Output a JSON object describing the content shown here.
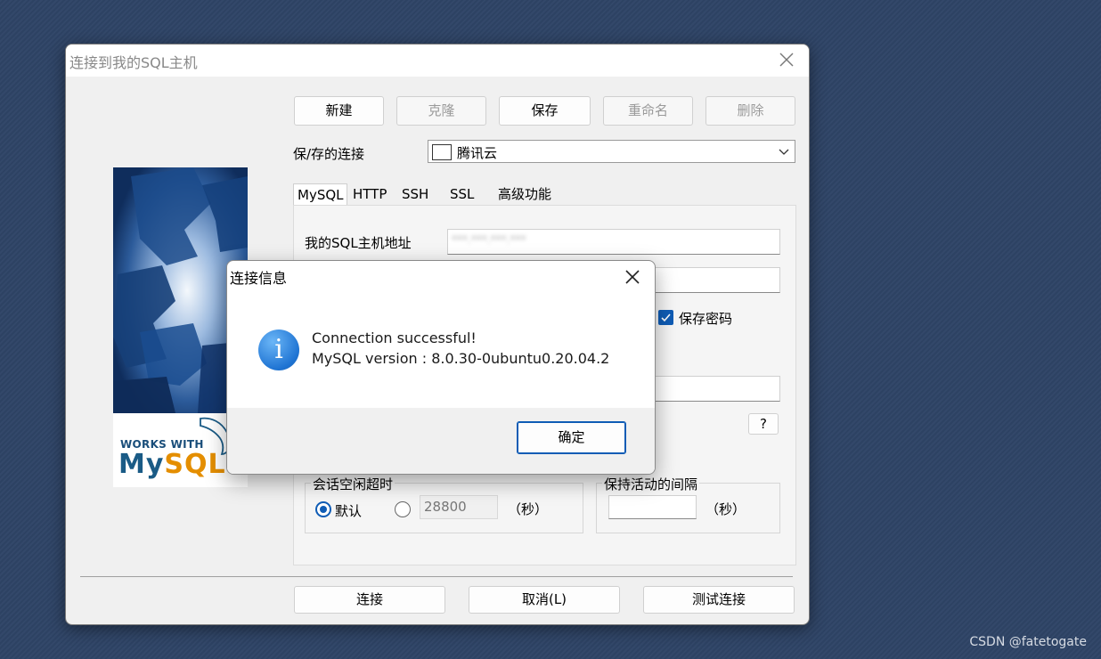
{
  "main_window": {
    "title": "连接到我的SQL主机",
    "toolbar": {
      "new": "新建",
      "clone": "克隆",
      "save": "保存",
      "rename": "重命名",
      "delete": "删除"
    },
    "saved_connection_label": "保/存的连接",
    "saved_connection_value": "腾讯云",
    "tabs": [
      "MySQL",
      "HTTP",
      "SSH",
      "SSL",
      "高级功能"
    ],
    "host_label": "我的SQL主机地址",
    "host_value": "***.***.***.***",
    "save_password_label": "保存密码",
    "help_label": "?",
    "session_idle_timeout": {
      "title": "会话空闲超时",
      "default_label": "默认",
      "custom_value": "28800",
      "unit": "（秒）"
    },
    "keepalive": {
      "title": "保持活动的间隔",
      "value": "",
      "unit": "（秒）"
    },
    "footer": {
      "connect": "连接",
      "cancel": "取消(L)",
      "test": "测试连接"
    },
    "logo": {
      "works_with": "WORKS WITH",
      "my": "My",
      "sql": "SQL"
    }
  },
  "dialog": {
    "title": "连接信息",
    "message_line1": "Connection successful!",
    "message_line2": "MySQL version : 8.0.30-0ubuntu0.20.04.2",
    "ok": "确定",
    "icon": "info-icon"
  },
  "watermark": "CSDN @fatetogate"
}
